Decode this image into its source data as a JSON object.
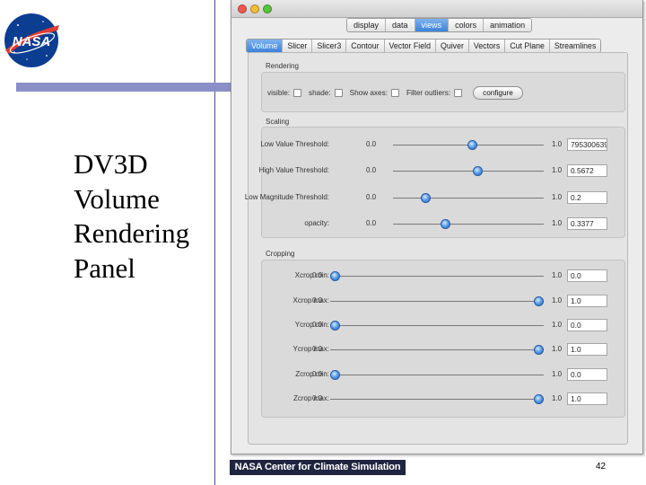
{
  "slide": {
    "title_lines": [
      "DV3D",
      "Volume",
      "Rendering",
      "Panel"
    ],
    "footer_banner": "NASA Center for Climate Simulation",
    "page_number": "42",
    "logo_text": "NASA",
    "colors": {
      "rule": "#4a4f93",
      "bar": "#8a8fc7",
      "banner": "#1f2440",
      "logo_blue": "#0b3d91",
      "logo_red": "#e03c31"
    }
  },
  "top_tabs": [
    {
      "label": "display",
      "active": false
    },
    {
      "label": "data",
      "active": false
    },
    {
      "label": "views",
      "active": true
    },
    {
      "label": "colors",
      "active": false
    },
    {
      "label": "animation",
      "active": false
    }
  ],
  "sub_tabs": [
    {
      "label": "Volume",
      "active": true
    },
    {
      "label": "Slicer",
      "active": false
    },
    {
      "label": "Slicer3",
      "active": false
    },
    {
      "label": "Contour",
      "active": false
    },
    {
      "label": "Vector Field",
      "active": false
    },
    {
      "label": "Quiver",
      "active": false
    },
    {
      "label": "Vectors",
      "active": false
    },
    {
      "label": "Cut Plane",
      "active": false
    },
    {
      "label": "Streamlines",
      "active": false
    }
  ],
  "rendering": {
    "group_label": "Rendering",
    "options": [
      {
        "label": "visible:",
        "checked": false
      },
      {
        "label": "shade:",
        "checked": false
      },
      {
        "label": "Show axes:",
        "checked": false
      },
      {
        "label": "Filter outliers:",
        "checked": false
      }
    ],
    "configure_label": "configure"
  },
  "scaling": {
    "group_label": "Scaling",
    "rows": [
      {
        "label": "Low Value Threshold:",
        "min": "0.0",
        "max": "1.0",
        "value": "795300639",
        "position": 0.53
      },
      {
        "label": "High Value Threshold:",
        "min": "0.0",
        "max": "1.0",
        "value": "0.5672",
        "position": 0.5672
      },
      {
        "label": "Low Magnitude Threshold:",
        "min": "0.0",
        "max": "1.0",
        "value": "0.2",
        "position": 0.2
      },
      {
        "label": "opacity:",
        "min": "0.0",
        "max": "1.0",
        "value": "0.3377",
        "position": 0.3377
      }
    ]
  },
  "cropping": {
    "group_label": "Cropping",
    "rows": [
      {
        "label": "Xcrop min:",
        "min": "0.0",
        "max": "1.0",
        "value": "0.0",
        "position": 0.0
      },
      {
        "label": "Xcrop max:",
        "min": "0.0",
        "max": "1.0",
        "value": "1.0",
        "position": 1.0
      },
      {
        "label": "Ycrop min:",
        "min": "0.0",
        "max": "1.0",
        "value": "0.0",
        "position": 0.0
      },
      {
        "label": "Ycrop max:",
        "min": "0.0",
        "max": "1.0",
        "value": "1.0",
        "position": 1.0
      },
      {
        "label": "Zcrop min:",
        "min": "0.0",
        "max": "1.0",
        "value": "0.0",
        "position": 0.0
      },
      {
        "label": "Zcrop max:",
        "min": "0.0",
        "max": "1.0",
        "value": "1.0",
        "position": 1.0
      }
    ]
  }
}
